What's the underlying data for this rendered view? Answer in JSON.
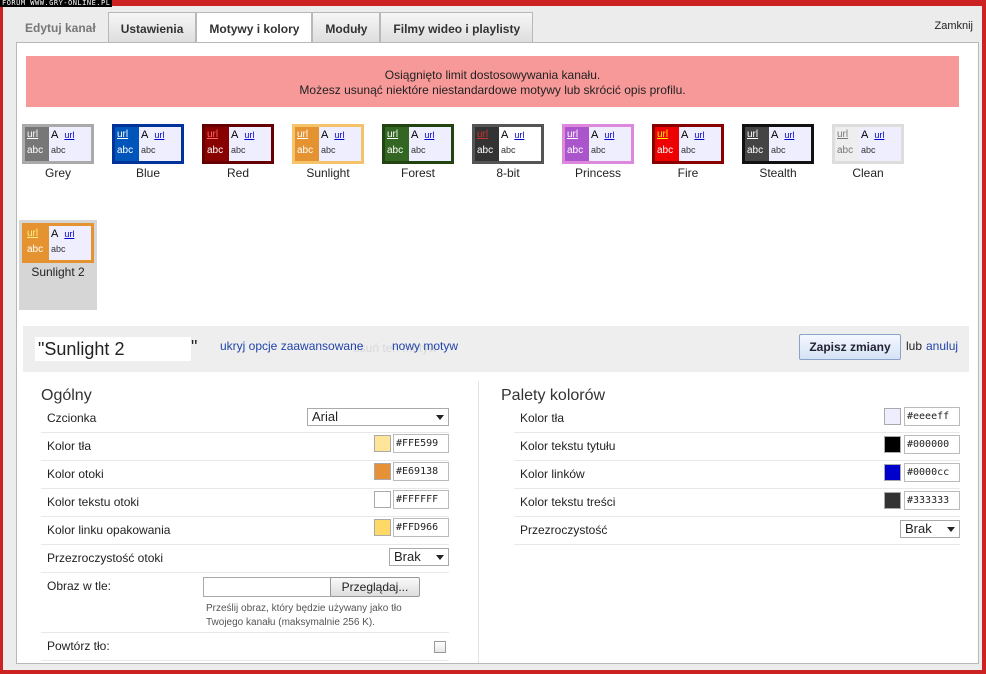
{
  "watermark": "FORUM WWW.GRY-ONLINE.PL",
  "tabs": {
    "edit_label": "Edytuj kanał",
    "items": [
      "Ustawienia",
      "Motywy i kolory",
      "Moduły",
      "Filmy wideo i playlisty"
    ],
    "close": "Zamknij"
  },
  "alert": {
    "line1": "Osiągnięto limit dostosowywania kanału.",
    "line2": "Możesz usunąć niektóre niestandardowe motywy lub skrócić opis profilu."
  },
  "themes": [
    {
      "name": "Grey",
      "border": "#aaaaaa",
      "left": "#777777",
      "url_color": "#ffffff",
      "abc_color": "#ffffff",
      "right": "#eeeeff"
    },
    {
      "name": "Blue",
      "border": "#003399",
      "left": "#0055bb",
      "url_color": "#ffffff",
      "abc_color": "#ffffff",
      "right": "#eeeeff"
    },
    {
      "name": "Red",
      "border": "#660000",
      "left": "#880000",
      "url_color": "#ff6666",
      "abc_color": "#ffffff",
      "right": "#eeeeff"
    },
    {
      "name": "Sunlight",
      "border": "#f4c36a",
      "left": "#e59330",
      "url_color": "#ffffff",
      "abc_color": "#ffffff",
      "right": "#eeeeff"
    },
    {
      "name": "Forest",
      "border": "#224411",
      "left": "#336622",
      "url_color": "#ffffff",
      "abc_color": "#ffffff",
      "right": "#eeeeff"
    },
    {
      "name": "8-bit",
      "border": "#555555",
      "left": "#333333",
      "url_color": "#cc3333",
      "abc_color": "#ffffff",
      "right": "#ffffff"
    },
    {
      "name": "Princess",
      "border": "#dd88dd",
      "left": "#aa55cc",
      "url_color": "#ffffff",
      "abc_color": "#ffffff",
      "right": "#eeeeff"
    },
    {
      "name": "Fire",
      "border": "#880000",
      "left": "#ee0000",
      "url_color": "#ffee00",
      "abc_color": "#ffffff",
      "right": "#eeeeff"
    },
    {
      "name": "Stealth",
      "border": "#111111",
      "left": "#444444",
      "url_color": "#ffffff",
      "abc_color": "#ffffff",
      "right": "#eeeeff"
    },
    {
      "name": "Clean",
      "border": "#dddddd",
      "left": "#eeeeee",
      "url_color": "#777777",
      "abc_color": "#777777",
      "right": "#eeeeff"
    },
    {
      "name": "Sunlight 2",
      "border": "#e59330",
      "left": "#e59330",
      "url_color": "#ffee88",
      "abc_color": "#ffffff",
      "right": "#eeeeff",
      "selected": true
    }
  ],
  "swatch_text": {
    "url": "url",
    "abc": "abc",
    "A": "A"
  },
  "editor": {
    "theme_name": "\"Sunlight 2",
    "quote_close": "\"",
    "hide_advanced": "ukryj opcje zaawansowane",
    "new_theme": "nowy motyw",
    "ghost_text": "usuń ten motyw",
    "save": "Zapisz zmiany",
    "or": "lub",
    "cancel": "anuluj"
  },
  "general": {
    "title": "Ogólny",
    "font_label": "Czcionka",
    "font_value": "Arial",
    "bg_label": "Kolor tła",
    "bg_hex": "#FFE599",
    "bg_color": "#ffe599",
    "border_label": "Kolor otoki",
    "border_hex": "#E69138",
    "border_color": "#e69138",
    "border_text_label": "Kolor tekstu otoki",
    "border_text_hex": "#FFFFFF",
    "border_text_color": "#ffffff",
    "wrap_link_label": "Kolor linku opakowania",
    "wrap_link_hex": "#FFD966",
    "wrap_link_color": "#ffd966",
    "opacity_label": "Przezroczystość otoki",
    "opacity_value": "Brak",
    "bg_image_label": "Obraz w tle:",
    "browse": "Przeglądaj...",
    "hint_line1": "Prześlij obraz, który będzie używany jako tło",
    "hint_line2": "Twojego kanału (maksymalnie 256 K).",
    "repeat_label": "Powtórz tło:"
  },
  "palette": {
    "title": "Palety kolorów",
    "bg_label": "Kolor tła",
    "bg_hex": "#eeeeff",
    "bg_color": "#eeeeff",
    "title_text_label": "Kolor tekstu tytułu",
    "title_text_hex": "#000000",
    "title_text_color": "#000000",
    "links_label": "Kolor linków",
    "links_hex": "#0000cc",
    "links_color": "#0000cc",
    "body_text_label": "Kolor tekstu treści",
    "body_text_hex": "#333333",
    "body_text_color": "#333333",
    "opacity_label": "Przezroczystość",
    "opacity_value": "Brak"
  }
}
